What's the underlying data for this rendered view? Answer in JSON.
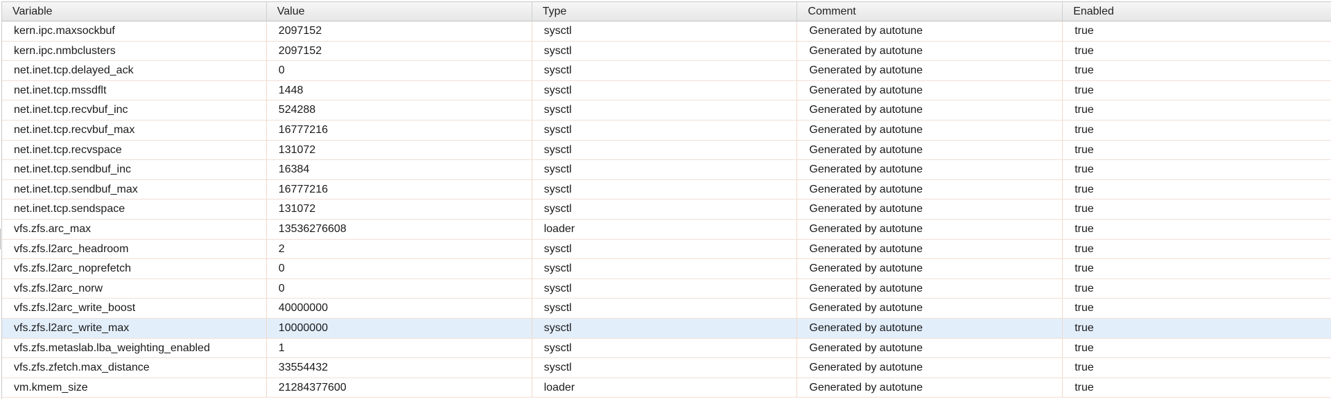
{
  "columns": [
    "Variable",
    "Value",
    "Type",
    "Comment",
    "Enabled"
  ],
  "selected_row": 15,
  "rows": [
    {
      "variable": "kern.ipc.maxsockbuf",
      "value": "2097152",
      "type": "sysctl",
      "comment": "Generated by autotune",
      "enabled": "true"
    },
    {
      "variable": "kern.ipc.nmbclusters",
      "value": "2097152",
      "type": "sysctl",
      "comment": "Generated by autotune",
      "enabled": "true"
    },
    {
      "variable": "net.inet.tcp.delayed_ack",
      "value": "0",
      "type": "sysctl",
      "comment": "Generated by autotune",
      "enabled": "true"
    },
    {
      "variable": "net.inet.tcp.mssdflt",
      "value": "1448",
      "type": "sysctl",
      "comment": "Generated by autotune",
      "enabled": "true"
    },
    {
      "variable": "net.inet.tcp.recvbuf_inc",
      "value": "524288",
      "type": "sysctl",
      "comment": "Generated by autotune",
      "enabled": "true"
    },
    {
      "variable": "net.inet.tcp.recvbuf_max",
      "value": "16777216",
      "type": "sysctl",
      "comment": "Generated by autotune",
      "enabled": "true"
    },
    {
      "variable": "net.inet.tcp.recvspace",
      "value": "131072",
      "type": "sysctl",
      "comment": "Generated by autotune",
      "enabled": "true"
    },
    {
      "variable": "net.inet.tcp.sendbuf_inc",
      "value": "16384",
      "type": "sysctl",
      "comment": "Generated by autotune",
      "enabled": "true"
    },
    {
      "variable": "net.inet.tcp.sendbuf_max",
      "value": "16777216",
      "type": "sysctl",
      "comment": "Generated by autotune",
      "enabled": "true"
    },
    {
      "variable": "net.inet.tcp.sendspace",
      "value": "131072",
      "type": "sysctl",
      "comment": "Generated by autotune",
      "enabled": "true"
    },
    {
      "variable": "vfs.zfs.arc_max",
      "value": "13536276608",
      "type": "loader",
      "comment": "Generated by autotune",
      "enabled": "true"
    },
    {
      "variable": "vfs.zfs.l2arc_headroom",
      "value": "2",
      "type": "sysctl",
      "comment": "Generated by autotune",
      "enabled": "true"
    },
    {
      "variable": "vfs.zfs.l2arc_noprefetch",
      "value": "0",
      "type": "sysctl",
      "comment": "Generated by autotune",
      "enabled": "true"
    },
    {
      "variable": "vfs.zfs.l2arc_norw",
      "value": "0",
      "type": "sysctl",
      "comment": "Generated by autotune",
      "enabled": "true"
    },
    {
      "variable": "vfs.zfs.l2arc_write_boost",
      "value": "40000000",
      "type": "sysctl",
      "comment": "Generated by autotune",
      "enabled": "true"
    },
    {
      "variable": "vfs.zfs.l2arc_write_max",
      "value": "10000000",
      "type": "sysctl",
      "comment": "Generated by autotune",
      "enabled": "true"
    },
    {
      "variable": "vfs.zfs.metaslab.lba_weighting_enabled",
      "value": "1",
      "type": "sysctl",
      "comment": "Generated by autotune",
      "enabled": "true"
    },
    {
      "variable": "vfs.zfs.zfetch.max_distance",
      "value": "33554432",
      "type": "sysctl",
      "comment": "Generated by autotune",
      "enabled": "true"
    },
    {
      "variable": "vm.kmem_size",
      "value": "21284377600",
      "type": "loader",
      "comment": "Generated by autotune",
      "enabled": "true"
    }
  ]
}
